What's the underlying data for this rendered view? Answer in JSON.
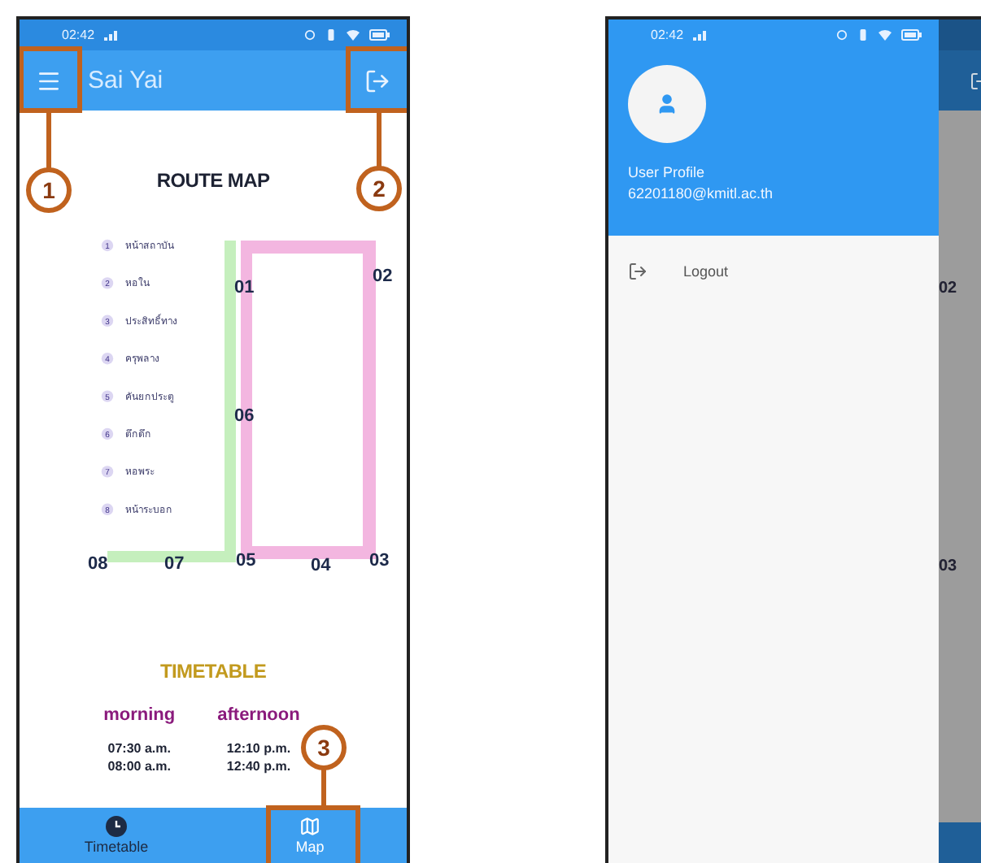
{
  "screens": [
    {
      "kind": "app",
      "status_bar": {
        "time": "02:42"
      },
      "app_bar": {
        "title": "Sai Yai"
      },
      "route_map": {
        "title": "ROUTE MAP",
        "stops": [
          {
            "number": "1",
            "name": "หน้าสถาบัน"
          },
          {
            "number": "2",
            "name": "หอใน"
          },
          {
            "number": "3",
            "name": "ประสิทธิ์ทาง"
          },
          {
            "number": "4",
            "name": "ครุพลาง"
          },
          {
            "number": "5",
            "name": "คันยกประตู"
          },
          {
            "number": "6",
            "name": "ตึกดึก"
          },
          {
            "number": "7",
            "name": "หอพระ"
          },
          {
            "number": "8",
            "name": "หน้าระบอก"
          }
        ],
        "map_labels": [
          "01",
          "02",
          "06",
          "08",
          "07",
          "05",
          "04",
          "03"
        ]
      },
      "timetable": {
        "title": "TIMETABLE",
        "columns": [
          {
            "heading": "morning",
            "times": [
              "07:30 a.m.",
              "08:00 a.m."
            ]
          },
          {
            "heading": "afternoon",
            "times": [
              "12:10 p.m.",
              "12:40 p.m."
            ]
          }
        ]
      },
      "bottom_nav": [
        {
          "label": "Timetable",
          "selected": false
        },
        {
          "label": "Map",
          "selected": true
        }
      ],
      "callouts": [
        "1",
        "2",
        "3"
      ]
    },
    {
      "kind": "drawer",
      "status_bar": {
        "time": "02:42"
      },
      "profile": {
        "title": "User Profile",
        "email": "62201180@kmitl.ac.th"
      },
      "menu": [
        {
          "label": "Logout"
        }
      ],
      "behind_labels": [
        "02",
        "03"
      ]
    }
  ]
}
